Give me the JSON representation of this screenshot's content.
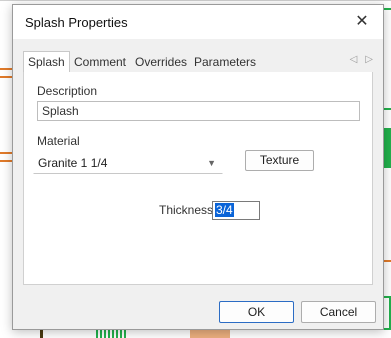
{
  "dialog": {
    "title": "Splash Properties",
    "close_glyph": "✕"
  },
  "tabs": [
    {
      "label": "Splash",
      "active": true
    },
    {
      "label": "Comment",
      "active": false
    },
    {
      "label": "Overrides",
      "active": false
    },
    {
      "label": "Parameters",
      "active": false
    }
  ],
  "tab_scroll": {
    "left_glyph": "◁",
    "right_glyph": "▷"
  },
  "fields": {
    "description_label": "Description",
    "description_value": "Splash",
    "material_label": "Material",
    "material_value": "Granite 1 1/4",
    "texture_button": "Texture",
    "thickness_label": "Thickness",
    "thickness_value": "3/4"
  },
  "footer": {
    "ok_label": "OK",
    "cancel_label": "Cancel"
  },
  "colors": {
    "selection": "#0a64d8",
    "background_line_green": "#22b14c",
    "background_line_orange": "#e07a2a"
  }
}
